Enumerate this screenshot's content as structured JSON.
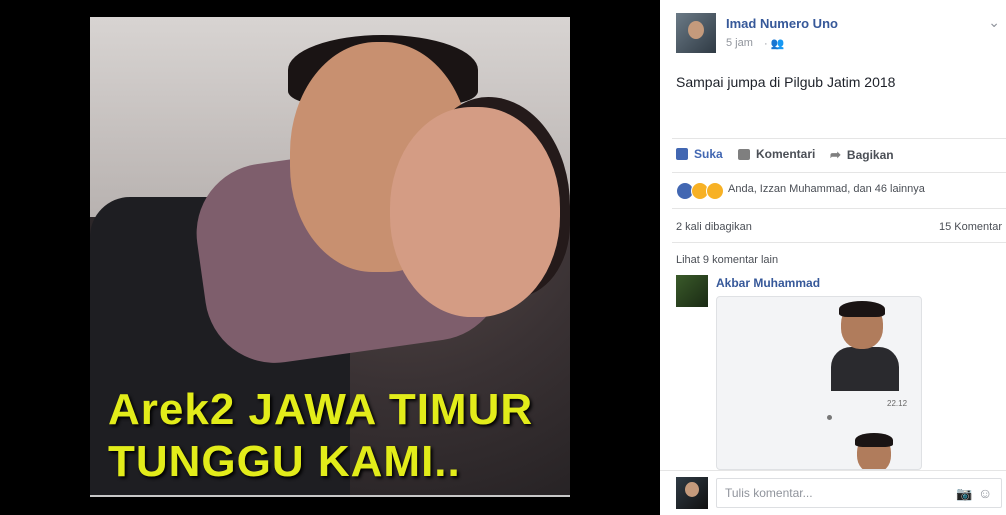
{
  "photo": {
    "caption_line1": "Arek2 JAWA TIMUR",
    "caption_line2": "TUNGGU KAMI..",
    "caption_color": "#e2ec1a"
  },
  "post": {
    "author": "Imad Numero Uno",
    "time": "5 jam",
    "audience_icon": "friends-icon",
    "text": "Sampai jumpa di Pilgub Jatim 2018"
  },
  "actions": {
    "like": "Suka",
    "comment": "Komentari",
    "share": "Bagikan"
  },
  "reactions": {
    "icons": [
      "like-icon",
      "haha-icon",
      "sad-icon"
    ],
    "text": "Anda, Izzan Muhammad, dan 46 lainnya"
  },
  "stats": {
    "shares": "2 kali dibagikan",
    "comments": "15 Komentar"
  },
  "comments": {
    "view_more": "Lihat 9 komentar lain",
    "items": [
      {
        "author": "Akbar Muhammad",
        "sticker_time": "22.12"
      }
    ]
  },
  "composer": {
    "placeholder": "Tulis komentar..."
  },
  "colors": {
    "link_blue": "#365899",
    "like_blue": "#4267b2",
    "viewer_bg": "#000000"
  }
}
